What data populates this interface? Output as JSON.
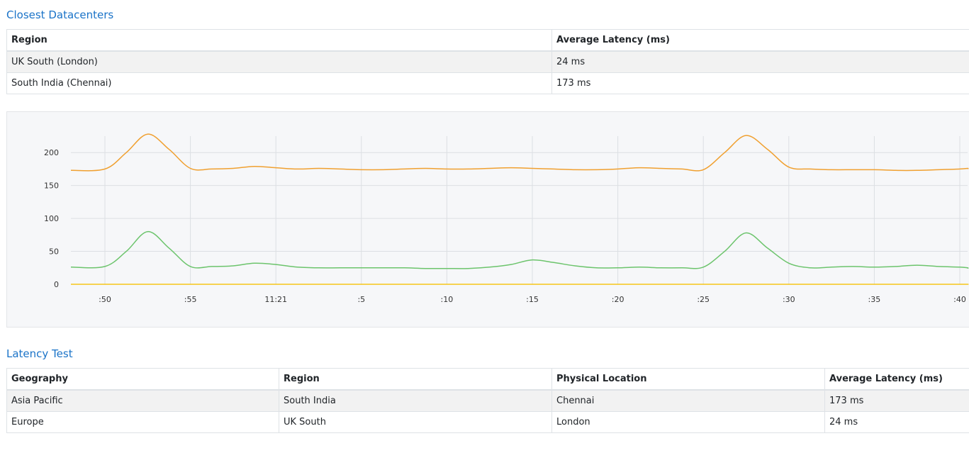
{
  "datacenters": {
    "title": "Closest Datacenters",
    "headers": [
      "Region",
      "Average Latency (ms)"
    ],
    "rows": [
      [
        "UK South (London)",
        "24 ms"
      ],
      [
        "South India (Chennai)",
        "173 ms"
      ]
    ]
  },
  "latency_test": {
    "title": "Latency Test",
    "headers": [
      "Geography",
      "Region",
      "Physical Location",
      "Average Latency (ms)"
    ],
    "rows": [
      [
        "Asia Pacific",
        "South India",
        "Chennai",
        "173 ms"
      ],
      [
        "Europe",
        "UK South",
        "London",
        "24 ms"
      ]
    ]
  },
  "chart_data": {
    "type": "line",
    "title": "",
    "xlabel": "",
    "ylabel": "",
    "ylim": [
      0,
      225
    ],
    "yticks": [
      0,
      50,
      100,
      150,
      200
    ],
    "x_tick_labels": [
      ":50",
      ":55",
      "11:21",
      ":5",
      ":10",
      ":15",
      ":20",
      ":25",
      ":30",
      ":35",
      ":40"
    ],
    "x_range_ticks": [
      -0.4,
      10.45
    ],
    "grid": true,
    "x": [
      -0.4,
      0,
      0.25,
      0.5,
      0.75,
      1,
      1.25,
      1.5,
      1.75,
      2,
      2.25,
      2.5,
      2.75,
      3,
      3.25,
      3.5,
      3.75,
      4,
      4.25,
      4.5,
      4.75,
      5,
      5.25,
      5.5,
      5.75,
      6,
      6.25,
      6.5,
      6.75,
      7,
      7.25,
      7.5,
      7.75,
      8,
      8.25,
      8.5,
      8.75,
      9,
      9.25,
      9.5,
      9.75,
      10,
      10.25,
      10.45
    ],
    "series": [
      {
        "color": "#f0a030",
        "values": [
          173,
          175,
          200,
          228,
          205,
          176,
          175,
          176,
          179,
          177,
          175,
          176,
          175,
          174,
          174,
          175,
          176,
          175,
          175,
          176,
          177,
          176,
          175,
          174,
          174,
          175,
          177,
          176,
          175,
          174,
          200,
          226,
          205,
          178,
          175,
          174,
          174,
          174,
          173,
          173,
          174,
          175,
          176,
          175
        ]
      },
      {
        "color": "#6cc46c",
        "values": [
          26,
          27,
          50,
          80,
          55,
          27,
          27,
          28,
          32,
          30,
          26,
          25,
          25,
          25,
          25,
          25,
          24,
          24,
          24,
          26,
          30,
          37,
          33,
          28,
          25,
          25,
          26,
          25,
          25,
          26,
          50,
          78,
          55,
          32,
          25,
          26,
          27,
          26,
          27,
          29,
          27,
          26,
          25,
          24
        ]
      },
      {
        "color": "#f5c518",
        "values": [
          0,
          0,
          0,
          0,
          0,
          0,
          0,
          0,
          0,
          0,
          0,
          0,
          0,
          0,
          0,
          0,
          0,
          0,
          0,
          0,
          0,
          0,
          0,
          0,
          0,
          0,
          0,
          0,
          0,
          0,
          0,
          0,
          0,
          0,
          0,
          0,
          0,
          0,
          0,
          0,
          0,
          0,
          0,
          0
        ]
      }
    ]
  }
}
